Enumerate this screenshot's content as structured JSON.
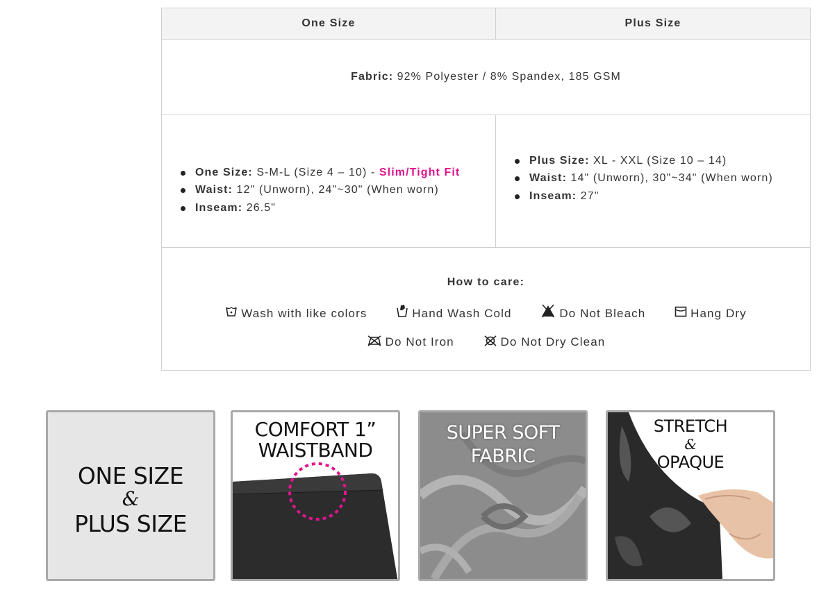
{
  "table": {
    "header_one_size": "One Size",
    "header_plus_size": "Plus Size",
    "fabric_label": "Fabric:",
    "fabric_value": " 92% Polyester / 8% Spandex, 185 GSM",
    "one_size": {
      "size_label": "One Size:",
      "size_value": " S-M-L (Size 4 – 10) - ",
      "fit_label": "Slim/Tight Fit",
      "waist_label": "Waist:",
      "waist_value": " 12\" (Unworn),  24\"~30\" (When worn)",
      "inseam_label": "Inseam:",
      "inseam_value": " 26.5\""
    },
    "plus_size": {
      "size_label": "Plus Size:",
      "size_value": " XL - XXL (Size 10 – 14)",
      "waist_label": "Waist:",
      "waist_value": " 14\" (Unworn),  30\"~34\" (When worn)",
      "inseam_label": "Inseam:",
      "inseam_value": " 27\""
    },
    "care": {
      "title": "How to care:",
      "items": [
        {
          "label": "Wash with like colors",
          "icon": "wash-tub-icon"
        },
        {
          "label": "Hand Wash Cold",
          "icon": "hand-wash-icon"
        },
        {
          "label": "Do Not Bleach",
          "icon": "no-bleach-icon"
        },
        {
          "label": "Hang Dry",
          "icon": "hang-dry-icon"
        },
        {
          "label": "Do Not Iron",
          "icon": "no-iron-icon"
        },
        {
          "label": "Do Not Dry Clean",
          "icon": "no-dry-clean-icon"
        }
      ]
    }
  },
  "tiles": [
    {
      "line1": "ONE SIZE",
      "line2": "&",
      "line3": "PLUS SIZE"
    },
    {
      "line1": "COMFORT 1”",
      "line2": "WAISTBAND"
    },
    {
      "line1": "SUPER SOFT",
      "line2": "FABRIC"
    },
    {
      "line1": "STRETCH",
      "line2": "&",
      "line3": "OPAQUE"
    }
  ],
  "colors": {
    "accent_pink": "#e0158c",
    "border": "#cfcfcf",
    "header_bg": "#f3f3f3",
    "tile_border": "#a9a9a9"
  }
}
